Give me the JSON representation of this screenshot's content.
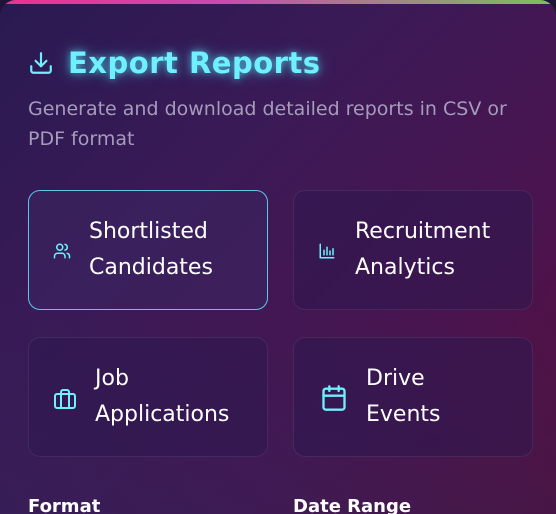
{
  "header": {
    "icon": "download-icon",
    "title": "Export Reports",
    "subtitle": "Generate and download detailed reports in CSV or PDF format"
  },
  "report_types": [
    {
      "line1": "Shortlisted",
      "line2": "Candidates",
      "icon": "users-icon",
      "selected": true
    },
    {
      "line1": "Recruitment",
      "line2": "Analytics",
      "icon": "bar-chart-icon",
      "selected": false
    },
    {
      "line1": "Job",
      "line2": "Applications",
      "icon": "briefcase-icon",
      "selected": false
    },
    {
      "line1": "Drive",
      "line2": "Events",
      "icon": "calendar-icon",
      "selected": false
    }
  ],
  "form": {
    "format_label": "Format",
    "date_range_label": "Date Range"
  },
  "colors": {
    "accent": "#6ff0ff",
    "selected_border": "#58c8ec",
    "subtitle": "#a59cbc"
  }
}
